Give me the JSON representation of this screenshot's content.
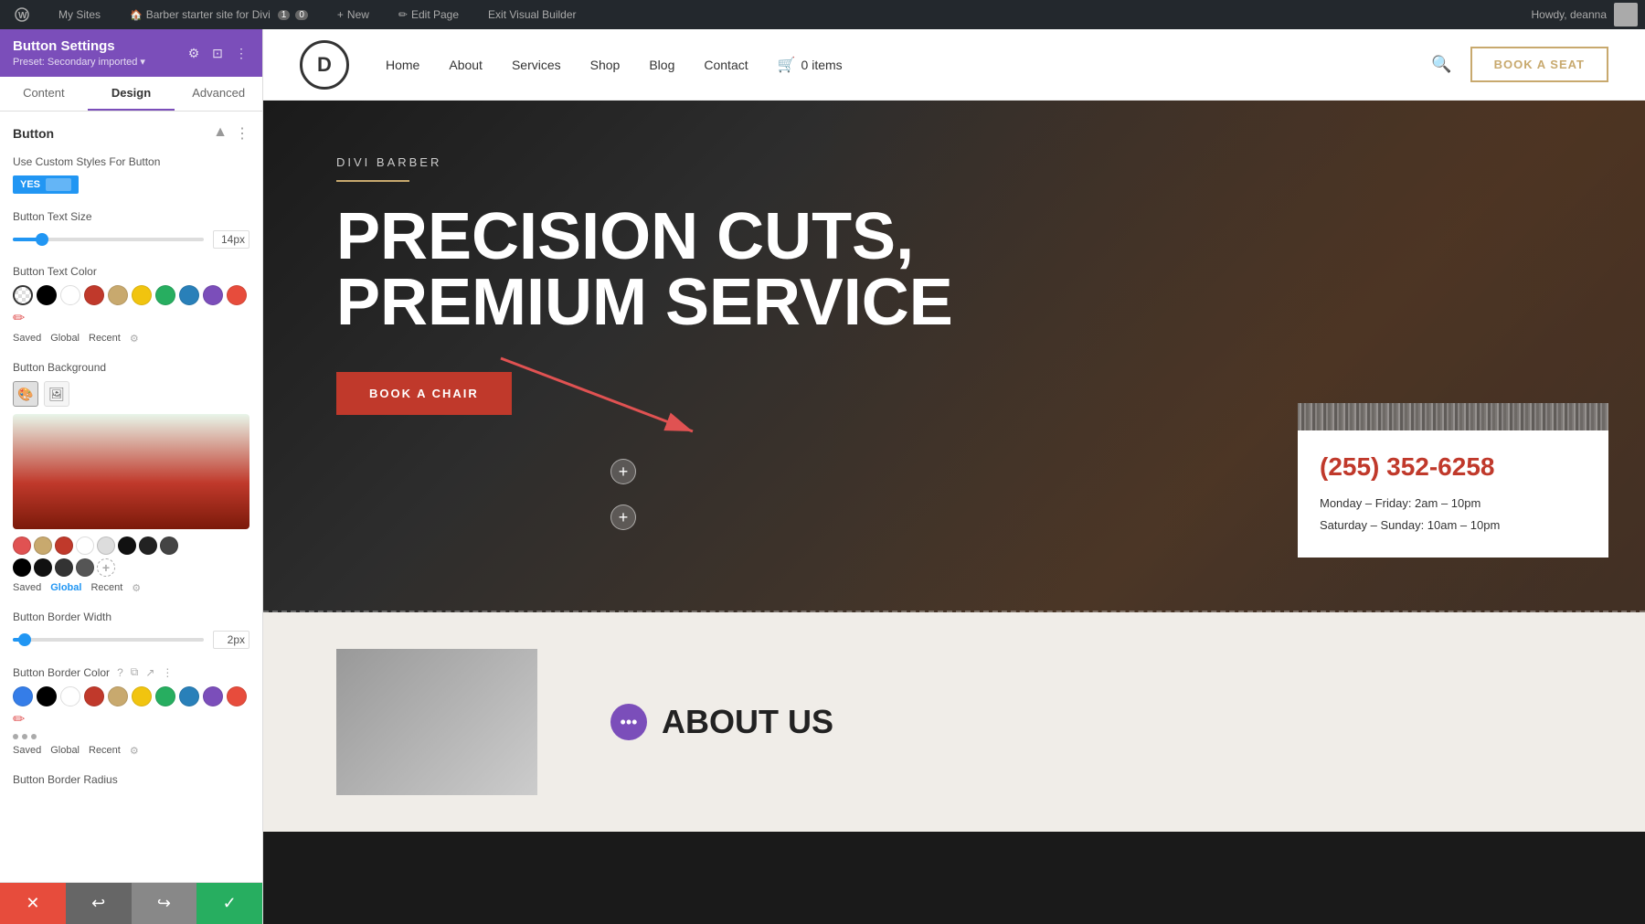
{
  "adminBar": {
    "wpIcon": "W",
    "mySites": "My Sites",
    "siteTitle": "Barber starter site for Divi",
    "comments": "1",
    "newLabel": "New",
    "editPage": "Edit Page",
    "exitBuilder": "Exit Visual Builder",
    "howdy": "Howdy, deanna"
  },
  "panel": {
    "title": "Button Settings",
    "preset": "Preset: Secondary imported ▾",
    "tabs": [
      "Content",
      "Design",
      "Advanced"
    ],
    "activeTab": "Design",
    "section": {
      "title": "Button",
      "settings": {
        "customStyles": {
          "label": "Use Custom Styles For Button",
          "value": "YES"
        },
        "textSize": {
          "label": "Button Text Size",
          "value": "14px",
          "sliderPercent": 15
        },
        "textColor": {
          "label": "Button Text Color",
          "metaLabels": [
            "Saved",
            "Global",
            "Recent"
          ]
        },
        "background": {
          "label": "Button Background"
        },
        "borderWidth": {
          "label": "Button Border Width",
          "value": "2px",
          "sliderPercent": 5
        },
        "borderColor": {
          "label": "Button Border Color",
          "metaLabels": [
            "Saved",
            "Global",
            "Recent"
          ]
        },
        "borderRadius": {
          "label": "Button Border Radius"
        }
      }
    }
  },
  "bottomButtons": {
    "cancel": "✕",
    "undo": "↩",
    "redo": "↪",
    "save": "✓"
  },
  "nav": {
    "logo": "D",
    "links": [
      "Home",
      "About",
      "Services",
      "Shop",
      "Blog",
      "Contact"
    ],
    "cart": "0 items",
    "bookBtn": "BOOK A SEAT"
  },
  "hero": {
    "subtitle": "DIVI BARBER",
    "title": "PRECISION CUTS, PREMIUM SERVICE",
    "ctaBtn": "BOOK A CHAIR"
  },
  "infoCard": {
    "phone": "(255) 352-6258",
    "hours1": "Monday – Friday: 2am – 10pm",
    "hours2": "Saturday – Sunday: 10am – 10pm"
  },
  "aboutSection": {
    "title": "ABOUT US"
  },
  "colors": {
    "accent": "#c0392b",
    "navAccent": "#c8a96e",
    "purple": "#7b4eba"
  },
  "swatches": {
    "textColor": [
      {
        "color": "transparent",
        "label": "transparent"
      },
      {
        "color": "#000000",
        "label": "black"
      },
      {
        "color": "#ffffff",
        "label": "white"
      },
      {
        "color": "#c0392b",
        "label": "red"
      },
      {
        "color": "#c8a96e",
        "label": "gold"
      },
      {
        "color": "#f1c40f",
        "label": "yellow"
      },
      {
        "color": "#27ae60",
        "label": "green"
      },
      {
        "color": "#2980b9",
        "label": "blue"
      },
      {
        "color": "#7b4eba",
        "label": "purple"
      },
      {
        "color": "#e74c3c",
        "label": "coral"
      },
      {
        "color": "#e056a0",
        "label": "pink"
      }
    ],
    "bgSmall": [
      {
        "color": "#e05252",
        "label": "coral-red"
      },
      {
        "color": "#c8a96e",
        "label": "gold"
      },
      {
        "color": "#c0392b",
        "label": "dark-red"
      },
      {
        "color": "#ffffff",
        "label": "white"
      },
      {
        "color": "#dddddd",
        "label": "light-gray"
      },
      {
        "color": "#111111",
        "label": "near-black"
      },
      {
        "color": "#222222",
        "label": "dark-gray1"
      },
      {
        "color": "#444444",
        "label": "dark-gray2"
      },
      {
        "color": "#000000",
        "label": "black"
      },
      {
        "color": "#111111",
        "label": "black2"
      },
      {
        "color": "#333333",
        "label": "black3"
      },
      {
        "color": "#555555",
        "label": "gray"
      }
    ],
    "borderColor": [
      {
        "color": "transparent",
        "label": "transparent"
      },
      {
        "color": "#000000",
        "label": "black"
      },
      {
        "color": "#ffffff",
        "label": "white"
      },
      {
        "color": "#c0392b",
        "label": "red"
      },
      {
        "color": "#c8a96e",
        "label": "gold"
      },
      {
        "color": "#f1c40f",
        "label": "yellow"
      },
      {
        "color": "#27ae60",
        "label": "green"
      },
      {
        "color": "#2980b9",
        "label": "blue"
      },
      {
        "color": "#7b4eba",
        "label": "purple"
      },
      {
        "color": "#e74c3c",
        "label": "coral"
      }
    ]
  }
}
